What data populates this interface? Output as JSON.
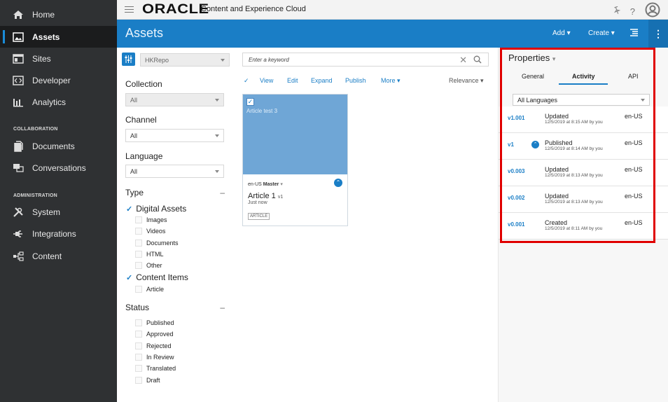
{
  "topbar": {
    "brand": "ORACLE",
    "product": "Content and Experience Cloud",
    "help_label": "?"
  },
  "sidenav": {
    "items": [
      {
        "label": "Home",
        "icon": "home-icon"
      },
      {
        "label": "Assets",
        "icon": "assets-icon",
        "active": true
      },
      {
        "label": "Sites",
        "icon": "sites-icon"
      },
      {
        "label": "Developer",
        "icon": "developer-icon"
      },
      {
        "label": "Analytics",
        "icon": "analytics-icon"
      }
    ],
    "collaboration": {
      "label": "COLLABORATION",
      "items": [
        {
          "label": "Documents",
          "icon": "documents-icon"
        },
        {
          "label": "Conversations",
          "icon": "conversations-icon"
        }
      ]
    },
    "administration": {
      "label": "ADMINISTRATION",
      "items": [
        {
          "label": "System",
          "icon": "system-icon"
        },
        {
          "label": "Integrations",
          "icon": "integrations-icon"
        },
        {
          "label": "Content",
          "icon": "content-icon"
        }
      ]
    }
  },
  "header": {
    "title": "Assets",
    "add_label": "Add",
    "create_label": "Create"
  },
  "filters": {
    "repository": "HKRepo",
    "collection": {
      "label": "Collection",
      "value": "All"
    },
    "channel": {
      "label": "Channel",
      "value": "All"
    },
    "language": {
      "label": "Language",
      "value": "All"
    },
    "type": {
      "label": "Type",
      "collapse": "–",
      "digital_assets": "Digital Assets",
      "digital_items": [
        "Images",
        "Videos",
        "Documents",
        "HTML",
        "Other"
      ],
      "content_items": "Content Items",
      "content_types": [
        "Article"
      ]
    },
    "status": {
      "label": "Status",
      "collapse": "–",
      "items": [
        "Published",
        "Approved",
        "Rejected",
        "In Review",
        "Translated",
        "Draft"
      ]
    }
  },
  "main": {
    "search_placeholder": "Enter a keyword",
    "toolbar": {
      "view": "View",
      "edit": "Edit",
      "expand": "Expand",
      "publish": "Publish",
      "more": "More"
    },
    "sort": "Relevance",
    "card": {
      "thumb_title": "Article test 3",
      "locale": "en-US",
      "master": "Master",
      "name": "Article 1",
      "version": "v1",
      "updated": "Just now",
      "type": "ARTICLE"
    }
  },
  "properties": {
    "title": "Properties",
    "tabs": [
      "General",
      "Activity",
      "API"
    ],
    "active_tab": "Activity",
    "language_filter": "All Languages",
    "activity": [
      {
        "version": "v1.001",
        "action": "Updated",
        "stamp": "12/5/2019 at 8:15 AM by you",
        "lang": "en-US",
        "published_icon": false
      },
      {
        "version": "v1",
        "action": "Published",
        "stamp": "12/5/2019 at 8:14 AM by you",
        "lang": "en-US",
        "published_icon": true
      },
      {
        "version": "v0.003",
        "action": "Updated",
        "stamp": "12/5/2019 at 8:13 AM by you",
        "lang": "en-US",
        "published_icon": false
      },
      {
        "version": "v0.002",
        "action": "Updated",
        "stamp": "12/5/2019 at 8:13 AM by you",
        "lang": "en-US",
        "published_icon": false
      },
      {
        "version": "v0.001",
        "action": "Created",
        "stamp": "12/5/2019 at 8:11 AM by you",
        "lang": "en-US",
        "published_icon": false
      }
    ]
  },
  "colors": {
    "accent": "#1a7ec6",
    "highlight_box": "#e00000",
    "sidenav": "#2f3133"
  }
}
